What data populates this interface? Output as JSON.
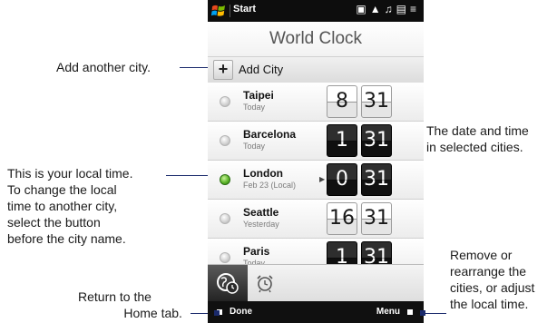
{
  "status_bar": {
    "start_label": "Start"
  },
  "app": {
    "title": "World Clock",
    "add_city_label": "Add City"
  },
  "cities": [
    {
      "name": "Taipei",
      "sub": "Today",
      "hour": "8",
      "minute": "31",
      "selected": false,
      "style": "light"
    },
    {
      "name": "Barcelona",
      "sub": "Today",
      "hour": "1",
      "minute": "31",
      "selected": false,
      "style": "dark"
    },
    {
      "name": "London",
      "sub": "Feb 23  (Local)",
      "hour": "0",
      "minute": "31",
      "selected": true,
      "style": "dark"
    },
    {
      "name": "Seattle",
      "sub": "Yesterday",
      "hour": "16",
      "minute": "31",
      "selected": false,
      "style": "light"
    },
    {
      "name": "Paris",
      "sub": "Today",
      "hour": "1",
      "minute": "31",
      "selected": false,
      "style": "dark"
    }
  ],
  "tabs": [
    {
      "icon": "world-clock-icon",
      "active": true
    },
    {
      "icon": "alarm-clock-icon",
      "active": false
    }
  ],
  "softkeys": {
    "left": "Done",
    "right": "Menu"
  },
  "annotations": {
    "add_city": "Add another city.",
    "date_time_1": "The date and time",
    "date_time_2": "in selected cities.",
    "local_1": "This is your local time.",
    "local_2": "To change the local",
    "local_3": "time to another city,",
    "local_4": "select the button",
    "local_5": "before the city name.",
    "home_1": "Return to the",
    "home_2": "Home tab.",
    "remove_1": "Remove or",
    "remove_2": "rearrange the",
    "remove_3": "cities, or adjust",
    "remove_4": "the local time."
  },
  "colors": {
    "callout_line": "#1a2a6c",
    "local_radio": "#5db52a"
  }
}
